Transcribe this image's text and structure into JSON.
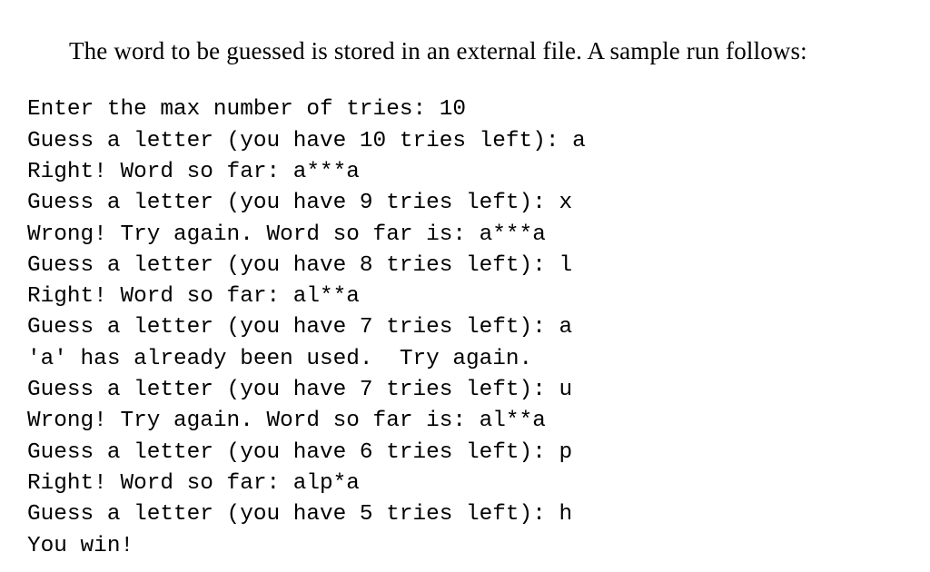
{
  "document": {
    "intro_sentence": "The word to be guessed is stored in an external file. A sample run follows:",
    "transcript_title": "sample run",
    "colors": {
      "background": "#ffffff",
      "text": "#000000"
    },
    "transcript_lines": [
      {
        "text": "Enter the max number of tries: 10"
      },
      {
        "text": "Guess a letter (you have 10 tries left): a"
      },
      {
        "text": "Right! Word so far: a***a"
      },
      {
        "text": "Guess a letter (you have 9 tries left): x"
      },
      {
        "text": "Wrong! Try again. Word so far is: a***a"
      },
      {
        "text": "Guess a letter (you have 8 tries left): l"
      },
      {
        "text": "Right! Word so far: al**a"
      },
      {
        "text": "Guess a letter (you have 7 tries left): a"
      },
      {
        "text": "'a' has already been used.  Try again."
      },
      {
        "text": "Guess a letter (you have 7 tries left): u"
      },
      {
        "text": "Wrong! Try again. Word so far is: al**a"
      },
      {
        "text": "Guess a letter (you have 6 tries left): p"
      },
      {
        "text": "Right! Word so far: alp*a"
      },
      {
        "text": "Guess a letter (you have 5 tries left): h"
      },
      {
        "text": "You win!"
      }
    ]
  }
}
